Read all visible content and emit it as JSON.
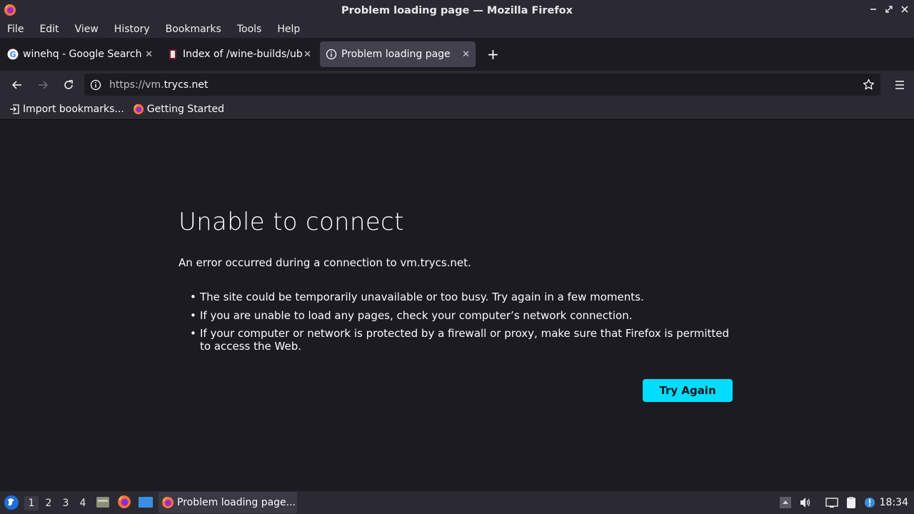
{
  "window": {
    "title": "Problem loading page — Mozilla Firefox",
    "app_icon": "firefox-icon",
    "controls": [
      "minimize-icon",
      "maximize-icon",
      "close-icon"
    ]
  },
  "menubar": {
    "items": [
      "File",
      "Edit",
      "View",
      "History",
      "Bookmarks",
      "Tools",
      "Help"
    ]
  },
  "tabs": [
    {
      "label": "winehq - Google Search",
      "icon": "google-icon",
      "active": false
    },
    {
      "label": "Index of /wine-builds/ubuntu",
      "icon": "wine-icon",
      "active": false
    },
    {
      "label": "Problem loading page",
      "icon": "info-icon",
      "active": true
    }
  ],
  "navbar": {
    "url_scheme": "https://vm.",
    "url_domain": "trycs.net"
  },
  "bookmarks": [
    {
      "label": "Import bookmarks...",
      "icon": "import-icon"
    },
    {
      "label": "Getting Started",
      "icon": "firefox-icon"
    }
  ],
  "error": {
    "title": "Unable to connect",
    "intro": "An error occurred during a connection to vm.trycs.net.",
    "bullets": [
      "The site could be temporarily unavailable or too busy. Try again in a few moments.",
      "If you are unable to load any pages, check your computer’s network connection.",
      "If your computer or network is protected by a firewall or proxy, make sure that Firefox is permitted to access the Web."
    ],
    "button": "Try Again"
  },
  "taskbar": {
    "workspaces": [
      "1",
      "2",
      "3",
      "4"
    ],
    "current_workspace": "1",
    "task_label": "Problem loading page...",
    "clock": "18:34"
  },
  "colors": {
    "accent": "#00ddff",
    "background": "#1c1b22",
    "toolbar": "#2b2a33"
  }
}
